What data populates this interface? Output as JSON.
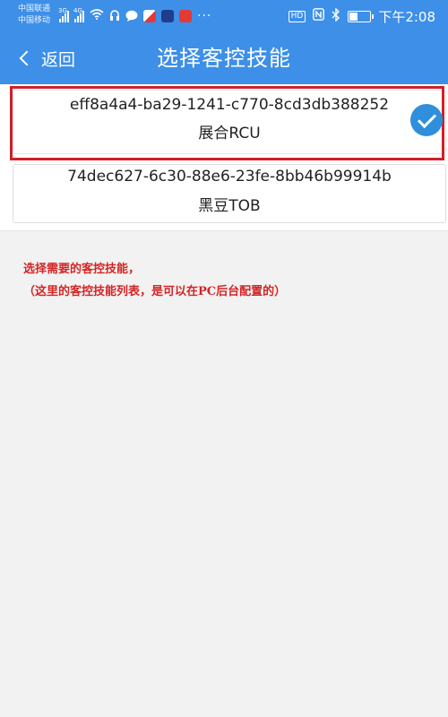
{
  "status_bar": {
    "carrier_1": "中国联通",
    "carrier_2": "中国移动",
    "net_1": "3G",
    "net_2": "4G",
    "hd_badge": "HD",
    "time": "下午2:08",
    "icons": [
      "signal-icon",
      "signal-icon",
      "wifi-icon",
      "headset-icon",
      "message-icon",
      "app-icon",
      "app-icon",
      "app-icon",
      "more-icon",
      "hd-icon",
      "nfc-icon",
      "bluetooth-icon",
      "battery-icon"
    ]
  },
  "header": {
    "back_label": "返回",
    "title": "选择客控技能"
  },
  "skills": [
    {
      "uuid": "eff8a4a4-ba29-1241-c770-8cd3db388252",
      "name": "展合RCU",
      "selected": true
    },
    {
      "uuid": "74dec627-6c30-88e6-23fe-8bb46b99914b",
      "name": "黑豆TOB",
      "selected": false
    }
  ],
  "annotation": {
    "line_1": "选择需要的客控技能，",
    "line_2": "（这里的客控技能列表，是可以在PC后台配置的）"
  },
  "colors": {
    "primary": "#3d8fe8",
    "check": "#2f8fdc",
    "annotation": "#d42424",
    "highlight": "#d0202a"
  }
}
